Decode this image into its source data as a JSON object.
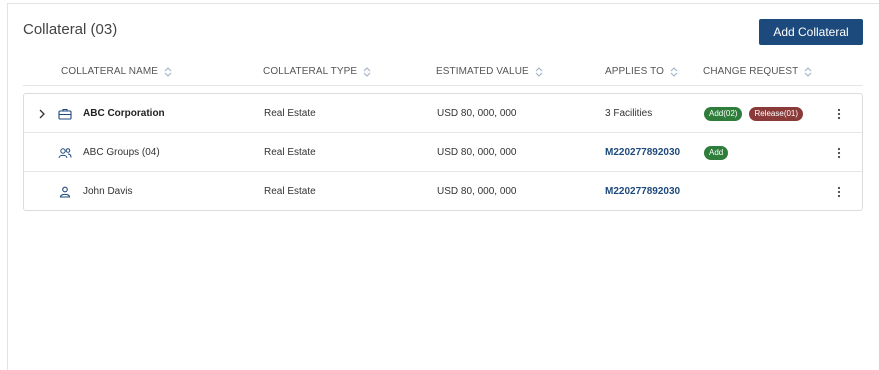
{
  "panel": {
    "title": "Collateral (03)",
    "add_button_label": "Add Collateral"
  },
  "columns": [
    {
      "label": "COLLATERAL NAME"
    },
    {
      "label": "COLLATERAL TYPE"
    },
    {
      "label": "ESTIMATED VALUE"
    },
    {
      "label": "APPLIES TO"
    },
    {
      "label": "CHANGE REQUEST"
    }
  ],
  "rows": [
    {
      "icon": "briefcase-icon",
      "name": "ABC Corporation",
      "type": "Real Estate",
      "value": "USD 80, 000, 000",
      "applies_to": "3 Facilities",
      "badges": [
        {
          "label": "Add(02)",
          "color": "#2e7d3a"
        },
        {
          "label": "Release(01)",
          "color": "#8b3a3a"
        }
      ]
    },
    {
      "icon": "group-icon",
      "name": "ABC Groups (04)",
      "type": "Real Estate",
      "value": "USD 80, 000, 000",
      "applies_to": "M220277892030",
      "badges": [
        {
          "label": "Add",
          "color": "#2e7d3a"
        }
      ]
    },
    {
      "icon": "person-icon",
      "name": "John Davis",
      "type": "Real Estate",
      "value": "USD 80, 000, 000",
      "applies_to": "M220277892030",
      "badges": []
    }
  ],
  "colors": {
    "primary": "#1d4a7c",
    "badge_add": "#2e7d3a",
    "badge_release": "#8b3a3a"
  }
}
